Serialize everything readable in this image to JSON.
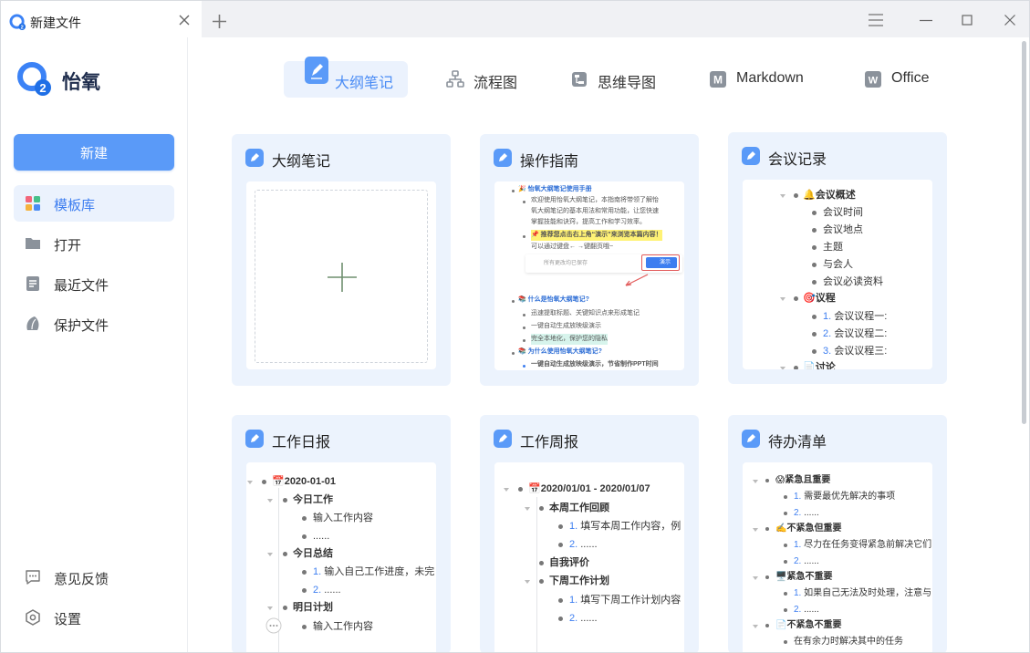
{
  "window": {
    "tab_title": "新建文件",
    "icons": {
      "tab_logo": "app-logo-icon",
      "tab_close": "close-icon",
      "new_tab": "plus-icon",
      "menu": "hamburger-icon",
      "minimize": "minimize-icon",
      "maximize": "maximize-icon",
      "close": "close-window-icon"
    }
  },
  "sidebar": {
    "brand": "怡氧",
    "new_button": "新建",
    "items": [
      {
        "label": "模板库",
        "icon": "template-icon",
        "active": true
      },
      {
        "label": "打开",
        "icon": "folder-icon",
        "active": false
      },
      {
        "label": "最近文件",
        "icon": "document-icon",
        "active": false
      },
      {
        "label": "保护文件",
        "icon": "shield-icon",
        "active": false
      }
    ],
    "bottom": [
      {
        "label": "意见反馈",
        "icon": "feedback-icon"
      },
      {
        "label": "设置",
        "icon": "settings-icon"
      }
    ]
  },
  "categories": [
    {
      "label": "大纲笔记",
      "icon": "outline-note-icon",
      "active": true
    },
    {
      "label": "流程图",
      "icon": "flowchart-icon",
      "active": false
    },
    {
      "label": "思维导图",
      "icon": "mindmap-icon",
      "active": false
    },
    {
      "label": "Markdown",
      "icon": "markdown-icon",
      "active": false
    },
    {
      "label": "Office",
      "icon": "office-icon",
      "active": false
    }
  ],
  "colors": {
    "accent": "#5a9af8",
    "active_bg": "#ebf2fd",
    "card_bg": "#ecf3fd"
  },
  "cards": {
    "blank": {
      "title": "大纲笔记"
    },
    "guide": {
      "title": "操作指南",
      "lines": [
        "🎉 怡氧大纲笔记使用手册",
        "欢迎使用怡氧大纲笔记，本指南将带领了解怡",
        "氧大纲笔记的基本用法和常用功能，让您快速",
        "掌握技能和诀窍，提高工作和学习效率。",
        "📌 推荐您点击右上角“演示”来浏览本篇内容！",
        "可以通过键盘← →键翻页哦~",
        "所有更改均已保存",
        "演示",
        "📚 什么是怡氧大纲笔记?",
        "迅速提取标题、关键知识点来形成笔记",
        "一键自动生成放映级演示",
        "完全本地化，保护您的隐私",
        "📚 为什么使用怡氧大纲笔记?",
        "一键自动生成放映级演示，节省制作PPT时间"
      ]
    },
    "meeting": {
      "title": "会议记录",
      "lines": [
        "🔔会议概述",
        "会议时间",
        "会议地点",
        "主题",
        "与会人",
        "会议必读资料",
        "🎯议程",
        "1.",
        "会议议程一:",
        "2.",
        "会议议程二:",
        "3.",
        "会议议程三:",
        "📄讨论"
      ]
    },
    "daily": {
      "title": "工作日报",
      "lines": [
        "📅2020-01-01",
        "今日工作",
        "输入工作内容",
        "......",
        "今日总结",
        "1.",
        "输入自己工作进度，未完",
        "2.",
        "......",
        "明日计划",
        "输入工作内容"
      ]
    },
    "weekly": {
      "title": "工作周报",
      "lines": [
        "📅2020/01/01 - 2020/01/07",
        "本周工作回顾",
        "1.",
        "填写本周工作内容，例",
        "2.",
        "......",
        "自我评价",
        "下周工作计划",
        "1.",
        "填写下周工作计划内容",
        "2.",
        "......"
      ]
    },
    "todo": {
      "title": "待办清单",
      "lines": [
        "😱紧急且重要",
        "1.",
        "需要最优先解决的事项",
        "2.",
        "......",
        "✍️不紧急但重要",
        "1.",
        "尽力在任务变得紧急前解决它们",
        "2.",
        "......",
        "🖥️紧急不重要",
        "1.",
        "如果自己无法及时处理，注意与",
        "2.",
        "......",
        "📄不紧急不重要",
        "在有余力时解决其中的任务"
      ]
    }
  }
}
